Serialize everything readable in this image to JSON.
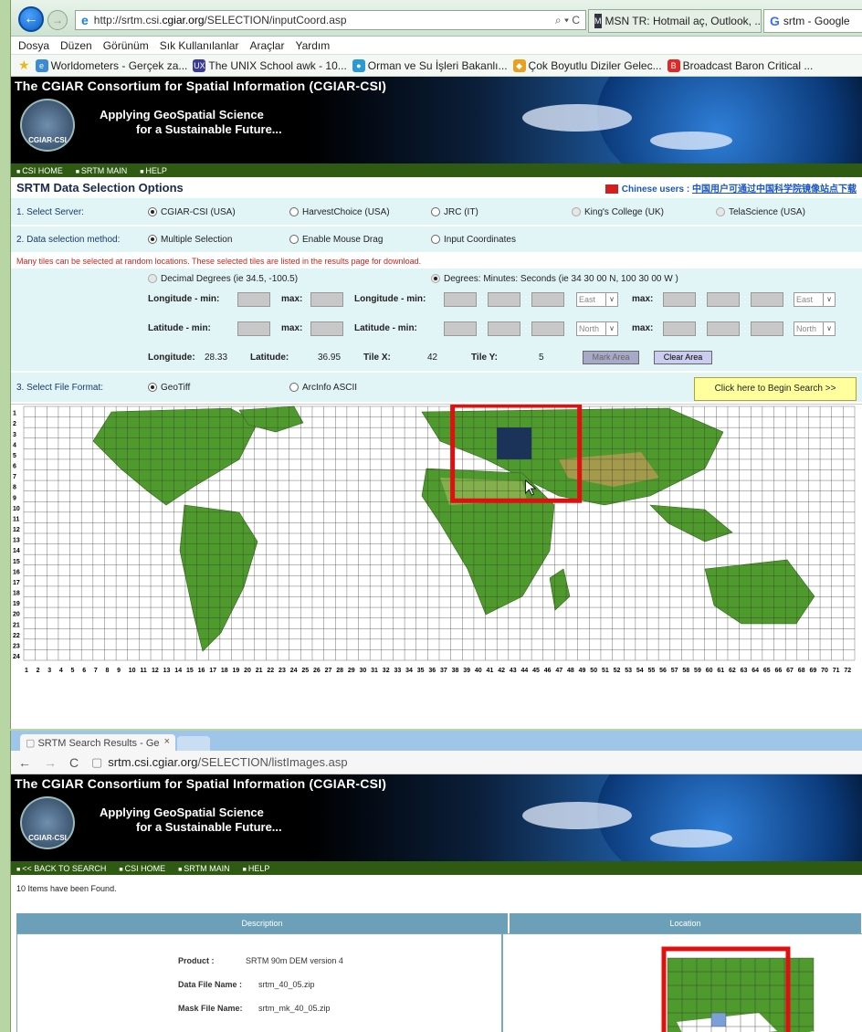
{
  "window1": {
    "url_prefix": "http://srtm.csi.",
    "url_domain": "cgiar.org",
    "url_path": "/SELECTION/inputCoord.asp",
    "address_controls": "⌕ ▾ C",
    "tabs": [
      {
        "label": "MSN TR: Hotmail aç, Outlook, ...",
        "badge": "M"
      },
      {
        "label": "srtm - Google",
        "icon": "G"
      }
    ],
    "menu": [
      "Dosya",
      "Düzen",
      "Görünüm",
      "Sık Kullanılanlar",
      "Araçlar",
      "Yardım"
    ],
    "favorites": [
      {
        "label": "Worldometers - Gerçek za...",
        "icon": "e",
        "color": "#3b8ad8"
      },
      {
        "label": "The UNIX School awk - 10...",
        "icon": "UX",
        "color": "#3a3a9a"
      },
      {
        "label": "Orman ve Su İşleri Bakanlı...",
        "icon": "●",
        "color": "#2a9ad0"
      },
      {
        "label": "Çok Boyutlu Diziler Gelec...",
        "icon": "◆",
        "color": "#e8a020"
      },
      {
        "label": "Broadcast Baron Critical ...",
        "icon": "B",
        "color": "#e02828"
      }
    ],
    "banner": {
      "title": "The CGIAR Consortium for Spatial Information (CGIAR-CSI)",
      "sub1": "Applying GeoSpatial Science",
      "sub2": "for a Sustainable Future...",
      "logo_text": "CGIAR-CSI"
    },
    "nav": [
      "CSI HOME",
      "SRTM MAIN",
      "HELP"
    ],
    "section_title": "SRTM Data Selection Options",
    "chinese_label": "Chinese users :",
    "chinese_link": "中国用户可通过中国科学院镜像站点下载",
    "server": {
      "label": "1. Select Server:",
      "options": [
        "CGIAR-CSI (USA)",
        "HarvestChoice (USA)",
        "JRC (IT)",
        "King's College (UK)",
        "TelaScience (USA)"
      ]
    },
    "method": {
      "label": "2. Data selection method:",
      "options": [
        "Multiple Selection",
        "Enable Mouse Drag",
        "Input Coordinates"
      ]
    },
    "warning": "Many tiles can be selected at random locations. These selected tiles are listed in the results page for download.",
    "coords": {
      "decimal": "Decimal Degrees (ie 34.5, -100.5)",
      "dms": "Degrees: Minutes: Seconds (ie 34 30 00 N, 100 30 00 W )",
      "lon_min": "Longitude - min:",
      "lat_min": "Latitude - min:",
      "max": "max:",
      "east": "East",
      "north": "North",
      "longitude_label": "Longitude:",
      "longitude_val": "28.33",
      "latitude_label": "Latitude:",
      "latitude_val": "36.95",
      "tilex_label": "Tile X:",
      "tilex_val": "42",
      "tiley_label": "Tile Y:",
      "tiley_val": "5",
      "mark_area": "Mark Area",
      "clear_area": "Clear Area"
    },
    "format": {
      "label": "3. Select File Format:",
      "options": [
        "GeoTiff",
        "ArcInfo ASCII"
      ],
      "begin": "Click here to Begin Search >>"
    },
    "grid": {
      "rows": [
        "1",
        "2",
        "3",
        "4",
        "5",
        "6",
        "7",
        "8",
        "9",
        "10",
        "11",
        "12",
        "13",
        "14",
        "15",
        "16",
        "17",
        "18",
        "19",
        "20",
        "21",
        "22",
        "23",
        "24"
      ],
      "cols": [
        "1",
        "2",
        "3",
        "4",
        "5",
        "6",
        "7",
        "8",
        "9",
        "10",
        "11",
        "12",
        "13",
        "14",
        "15",
        "16",
        "17",
        "18",
        "19",
        "20",
        "21",
        "22",
        "23",
        "24",
        "25",
        "26",
        "27",
        "28",
        "29",
        "30",
        "31",
        "32",
        "33",
        "34",
        "35",
        "36",
        "37",
        "38",
        "39",
        "40",
        "41",
        "42",
        "43",
        "44",
        "45",
        "46",
        "47",
        "48",
        "49",
        "50",
        "51",
        "52",
        "53",
        "54",
        "55",
        "56",
        "57",
        "58",
        "59",
        "60",
        "61",
        "62",
        "63",
        "64",
        "65",
        "66",
        "67",
        "68",
        "69",
        "70",
        "71",
        "72"
      ]
    }
  },
  "window2": {
    "tab_title": "SRTM Search Results - Ge",
    "tab_close": "×",
    "url_domain": "srtm.csi.cgiar.org",
    "url_path": "/SELECTION/listImages.asp",
    "nav": [
      "<< BACK TO SEARCH",
      "CSI HOME",
      "SRTM MAIN",
      "HELP"
    ],
    "found": "10 Items have been Found.",
    "headers": [
      "Description",
      "Location"
    ],
    "product_label": "Product :",
    "product_val": "SRTM 90m DEM version 4",
    "datafile_label": "Data File Name :",
    "datafile_val": "srtm_40_05.zip",
    "maskfile_label": "Mask File Name:",
    "maskfile_val": "srtm_mk_40_05.zip"
  },
  "colors": {
    "highlight": "#e01010",
    "selected_tile": "#1b3358",
    "nav_green": "#2f5a12",
    "land": "#4f9a2c"
  }
}
